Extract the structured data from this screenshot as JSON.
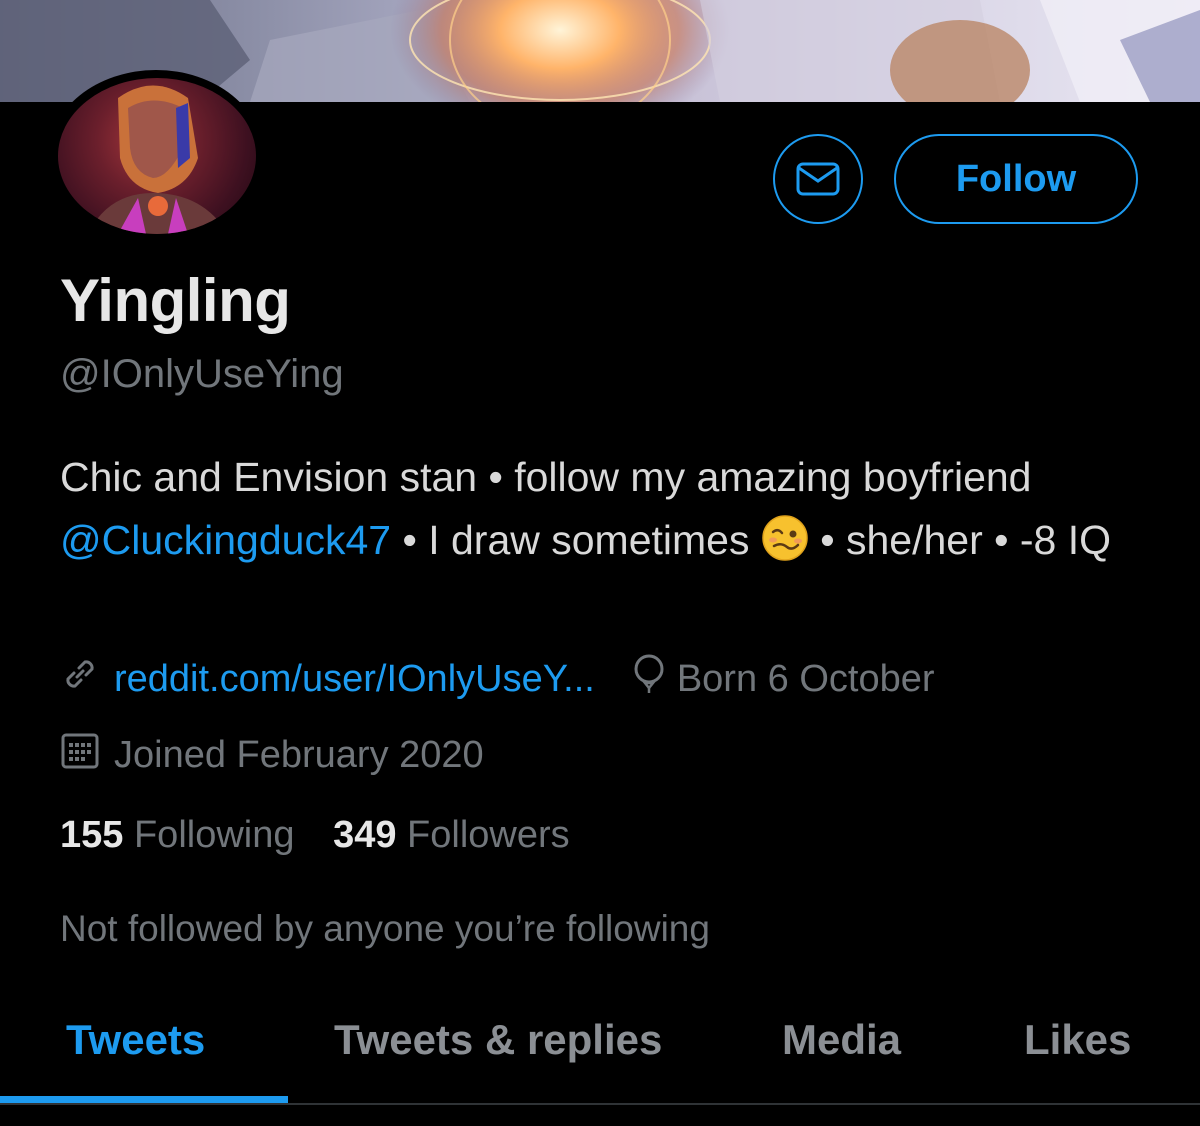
{
  "colors": {
    "accent": "#1d9bf0",
    "background": "#000000",
    "secondary_text": "#71767b",
    "primary_text": "#e7e7e7"
  },
  "profile": {
    "display_name": "Yingling",
    "handle": "@IOnlyUseYing",
    "bio": {
      "part1": "Chic and Envision stan • follow my amazing boyfriend ",
      "mention": "@Cluckingduck47",
      "part2": " • I draw sometimes ",
      "emoji": "woozy-face-emoji",
      "part3": " • she/her • -8 IQ"
    },
    "website": "reddit.com/user/IOnlyUseY...",
    "birthday": "Born 6 October",
    "joined": "Joined February 2020"
  },
  "actions": {
    "message_icon": "envelope-icon",
    "follow_label": "Follow"
  },
  "stats": {
    "following_count": "155",
    "following_label": "Following",
    "followers_count": "349",
    "followers_label": "Followers"
  },
  "followed_by_note": "Not followed by anyone you’re following",
  "tabs": [
    {
      "label": "Tweets",
      "active": true
    },
    {
      "label": "Tweets & replies",
      "active": false
    },
    {
      "label": "Media",
      "active": false
    },
    {
      "label": "Likes",
      "active": false
    }
  ]
}
